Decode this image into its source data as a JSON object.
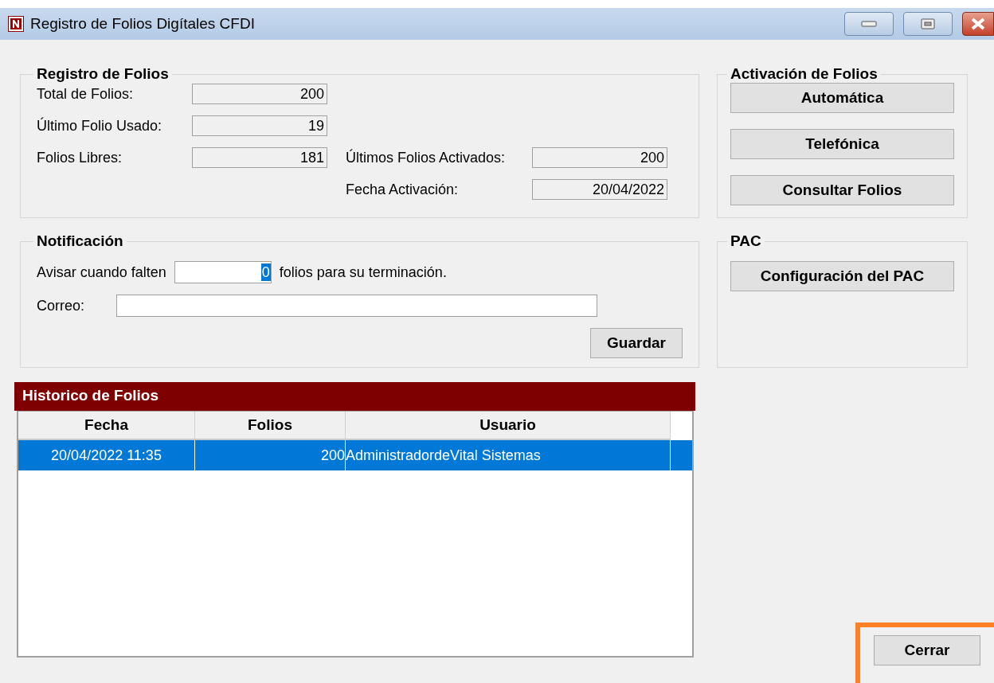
{
  "window": {
    "title": "Registro de Folios Digítales CFDI"
  },
  "registro": {
    "title": "Registro de Folios",
    "fields": [
      {
        "label": "Total de Folios:",
        "value": "200"
      },
      {
        "label": "Último Folio Usado:",
        "value": "19"
      },
      {
        "label": "Folios Libres:",
        "value": "181"
      }
    ],
    "fields_right": [
      {
        "label": "Últimos Folios Activados:",
        "value": "200"
      },
      {
        "label": "Fecha Activación:",
        "value": "20/04/2022"
      }
    ]
  },
  "notificacion": {
    "title": "Notificación",
    "prefix": "Avisar cuando falten",
    "count": {
      "value": "0",
      "selected": true
    },
    "suffix": "folios para su terminación.",
    "correo_label": "Correo:",
    "save_button": "Guardar"
  },
  "activacion": {
    "title": "Activación de Folios",
    "buttons": [
      "Automática",
      "Telefónica",
      "Consultar Folios"
    ]
  },
  "pac": {
    "title": "PAC",
    "buttons": [
      "Configuración del PAC"
    ]
  },
  "historico": {
    "title": "Historico de Folios",
    "columns": [
      "Fecha",
      "Folios",
      "Usuario"
    ],
    "rows": [
      {
        "cells": [
          "20/04/2022 11:35",
          "200",
          "AdministradordeVital Sistemas"
        ],
        "selected": true
      }
    ]
  },
  "close_button": {
    "label": "Cerrar",
    "highlighted": true
  }
}
